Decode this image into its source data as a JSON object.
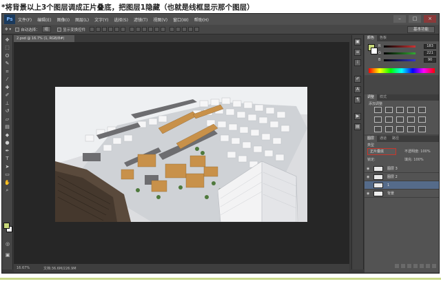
{
  "caption": "*将背景以上3个图层调成正片叠底，把图层1隐藏（也就是线框显示那个图层）",
  "app": {
    "logo": "Ps",
    "menu": [
      "文件(F)",
      "编辑(E)",
      "图像(I)",
      "图层(L)",
      "文字(Y)",
      "选择(S)",
      "滤镜(T)",
      "视图(V)",
      "窗口(W)",
      "帮助(H)"
    ],
    "window_buttons": [
      "–",
      "□",
      "×"
    ],
    "workspace": "基本功能"
  },
  "options_bar": {
    "auto_select_label": "自动选择：",
    "auto_select_value": "组",
    "show_transform_label": "显示变换控件"
  },
  "document": {
    "tab_title": "2.psd @ 16.7% (1, RGB/8#)",
    "zoom": "16.67%",
    "doc_info": "文档:36.6M/226.9M"
  },
  "color_panel": {
    "tabs": [
      "颜色",
      "色板"
    ],
    "channels": [
      {
        "label": "R",
        "value": "183",
        "color": "#c44"
      },
      {
        "label": "G",
        "value": "221",
        "color": "#4a4"
      },
      {
        "label": "B",
        "value": "90",
        "color": "#44c"
      }
    ]
  },
  "adjust_panel": {
    "tabs": [
      "调整",
      "样式"
    ],
    "heading": "添加调整"
  },
  "layers_panel": {
    "tabs": [
      "图层",
      "通道",
      "路径"
    ],
    "kind_label": "类型",
    "blend_mode": "正片叠底",
    "opacity_label": "不透明度:",
    "opacity_value": "100%",
    "lock_label": "锁定:",
    "fill_label": "填充:",
    "fill_value": "100%",
    "layers": [
      {
        "name": "图层 3",
        "visible": true,
        "active": false
      },
      {
        "name": "图层 2",
        "visible": true,
        "active": false
      },
      {
        "name": "1",
        "visible": false,
        "active": true
      },
      {
        "name": "背景",
        "visible": true,
        "active": false
      }
    ]
  }
}
